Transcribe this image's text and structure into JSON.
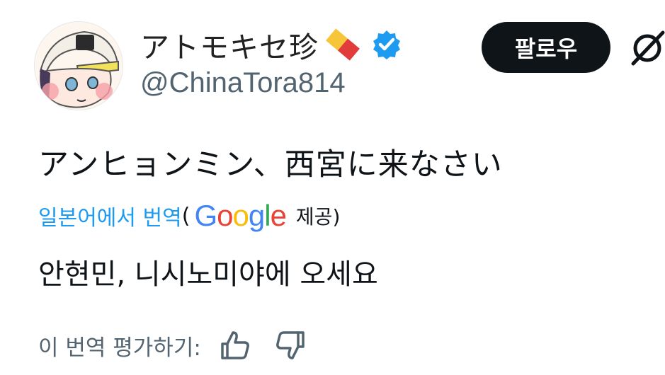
{
  "author": {
    "display_name": "アトモキセ珍",
    "handle": "@ChinaTora814",
    "pill_icon": "pill-emoji",
    "verified_icon": "verified-badge-icon"
  },
  "follow_button": {
    "label": "팔로우"
  },
  "tweet": {
    "text": "アンヒョンミン、西宮に来なさい",
    "translate_link": "일본어에서 번역",
    "paren_open": "(",
    "google": [
      "G",
      "o",
      "o",
      "g",
      "l",
      "e"
    ],
    "provided": "제공)",
    "translated_text": "안현민, 니시노미야에 오세요"
  },
  "rating": {
    "label": "이 번역 평가하기:"
  },
  "colors": {
    "link": "#1d9bf0",
    "muted": "#536471",
    "verified": "#1d9bf0",
    "google_blue": "#4285F4",
    "google_red": "#EA4335",
    "google_yellow": "#FBBC05",
    "google_green": "#34A853"
  }
}
